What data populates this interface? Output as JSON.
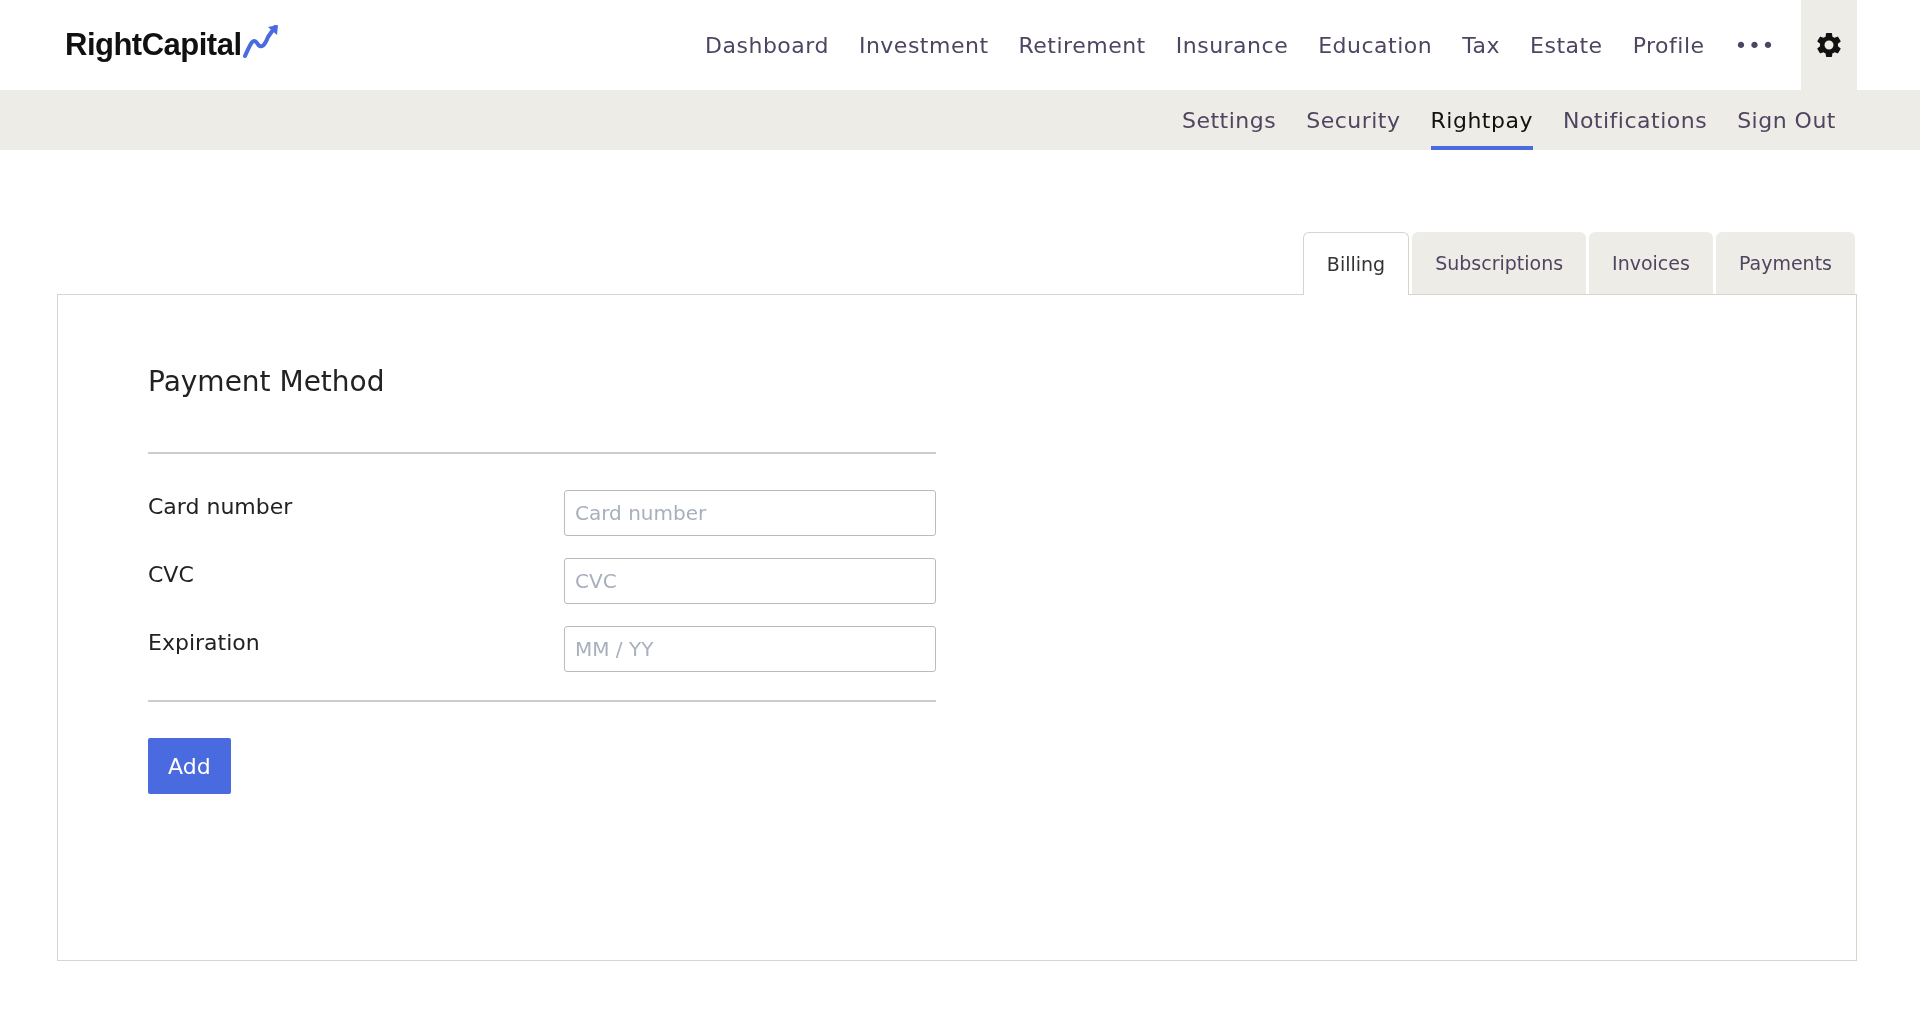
{
  "logo": {
    "text": "RightCapital"
  },
  "main_nav": [
    {
      "label": "Dashboard"
    },
    {
      "label": "Investment"
    },
    {
      "label": "Retirement"
    },
    {
      "label": "Insurance"
    },
    {
      "label": "Education"
    },
    {
      "label": "Tax"
    },
    {
      "label": "Estate"
    },
    {
      "label": "Profile"
    },
    {
      "label": "•••"
    }
  ],
  "sub_nav": [
    {
      "label": "Settings",
      "selected": false
    },
    {
      "label": "Security",
      "selected": false
    },
    {
      "label": "Rightpay",
      "selected": true
    },
    {
      "label": "Notifications",
      "selected": false
    },
    {
      "label": "Sign Out",
      "selected": false
    }
  ],
  "tabs": [
    {
      "label": "Billing",
      "selected": true
    },
    {
      "label": "Subscriptions",
      "selected": false
    },
    {
      "label": "Invoices",
      "selected": false
    },
    {
      "label": "Payments",
      "selected": false
    }
  ],
  "form": {
    "title": "Payment Method",
    "fields": [
      {
        "label": "Card number",
        "placeholder": "Card number"
      },
      {
        "label": "CVC",
        "placeholder": "CVC"
      },
      {
        "label": "Expiration",
        "placeholder": "MM / YY"
      }
    ],
    "button": "Add"
  }
}
